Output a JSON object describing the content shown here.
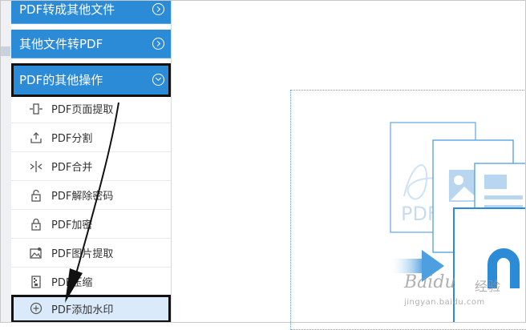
{
  "sidebar": {
    "categories": [
      {
        "label": "PDF转成其他文件",
        "state": "collapsed"
      },
      {
        "label": "其他文件转PDF",
        "state": "collapsed"
      },
      {
        "label": "PDF的其他操作",
        "state": "expanded"
      }
    ],
    "items": [
      {
        "label": "PDF页面提取",
        "icon": "page-extract-icon"
      },
      {
        "label": "PDF分割",
        "icon": "split-icon"
      },
      {
        "label": "PDF合并",
        "icon": "merge-icon"
      },
      {
        "label": "PDF解除密码",
        "icon": "unlock-icon"
      },
      {
        "label": "PDF加密",
        "icon": "lock-icon"
      },
      {
        "label": "PDF图片提取",
        "icon": "image-extract-icon"
      },
      {
        "label": "PDF压缩",
        "icon": "compress-icon"
      },
      {
        "label": "PDF添加水印",
        "icon": "add-watermark-icon",
        "selected": true
      }
    ]
  },
  "illustration": {
    "doc_label": "PDF"
  },
  "watermark": {
    "main": "Baidu",
    "cn": "经验",
    "url": "jingyan.baidu.com"
  },
  "colors": {
    "accent": "#2b8bd6",
    "selected_bg": "#dbeafa",
    "border_accent": "#5aa3e0"
  }
}
